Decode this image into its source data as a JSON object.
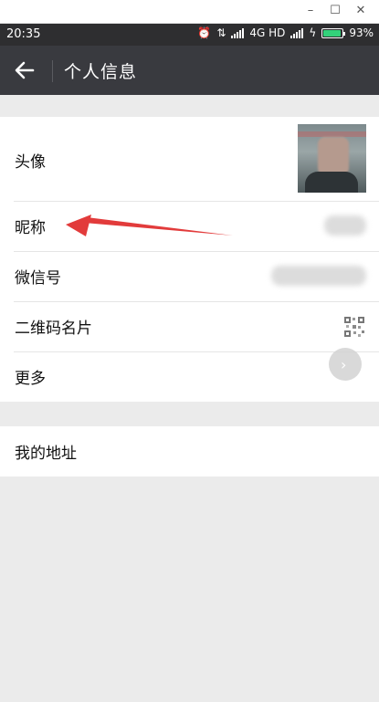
{
  "window": {
    "minimize": "–",
    "maximize": "☐",
    "close": "✕"
  },
  "statusbar": {
    "time": "20:35",
    "network": "4G HD",
    "battery": "93%",
    "battery_level": 0.93
  },
  "appbar": {
    "back_icon": "arrow-left-icon",
    "title": "个人信息"
  },
  "profile": {
    "avatar_label": "头像",
    "nickname_label": "昵称",
    "wechat_id_label": "微信号",
    "qrcode_label": "二维码名片",
    "more_label": "更多"
  },
  "address": {
    "label": "我的地址"
  },
  "annotation": {
    "color": "#e23b3b",
    "icon": "red-arrow"
  },
  "colors": {
    "appbar": "#393a3f",
    "statusbar": "#2e2e30",
    "background": "#ebebeb"
  }
}
